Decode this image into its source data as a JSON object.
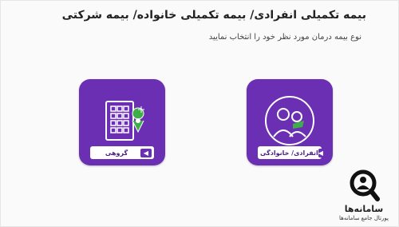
{
  "page": {
    "title": "بیمه تکمیلی انفرادی/ بیمه تکمیلی خانواده/ بیمه شرکتی",
    "subtitle": "نوع بیمه درمان مورد نظر خود را انتخاب نمایید"
  },
  "options": [
    {
      "label": "گروهی",
      "icon": "building-location-icon"
    },
    {
      "label": "انفرادی/ خانوادگی",
      "icon": "family-icon"
    }
  ],
  "logo": {
    "name": "سامانه‌ها",
    "tagline": "پورتال جامع سامانه‌ها",
    "icon": "magnifier-person-icon"
  },
  "colors": {
    "accent": "#6b2fb3",
    "pin": "#3fae49",
    "background": "#fafafa"
  }
}
